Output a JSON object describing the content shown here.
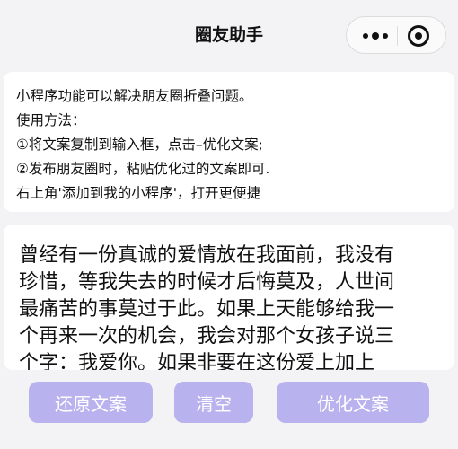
{
  "navbar": {
    "title": "圈友助手",
    "more_icon": "more-dots-icon",
    "close_icon": "circle-close-icon"
  },
  "info": {
    "lines": [
      "小程序功能可以解决朋友圈折叠问题。",
      "使用方法：",
      "①将文案复制到输入框，点击–优化文案;",
      "②发布朋友圈时，粘贴优化过的文案即可.",
      "右上角'添加到我的小程序'，打开更便捷"
    ]
  },
  "textarea": {
    "lines": [
      "曾经有一份真诚的爱情放在我面前，我没有",
      "珍惜，等我失去的时候才后悔莫及，人世间",
      "最痛苦的事莫过于此。如果上天能够给我一",
      "个再来一次的机会，我会对那个女孩子说三",
      "个字：我爱你。如果非要在这份爱上加上"
    ]
  },
  "buttons": {
    "restore": "还原文案",
    "clear": "清空",
    "optimize": "优化文案"
  },
  "colors": {
    "button_bg": "#b8b2ee",
    "page_bg": "#f3f3f5"
  }
}
